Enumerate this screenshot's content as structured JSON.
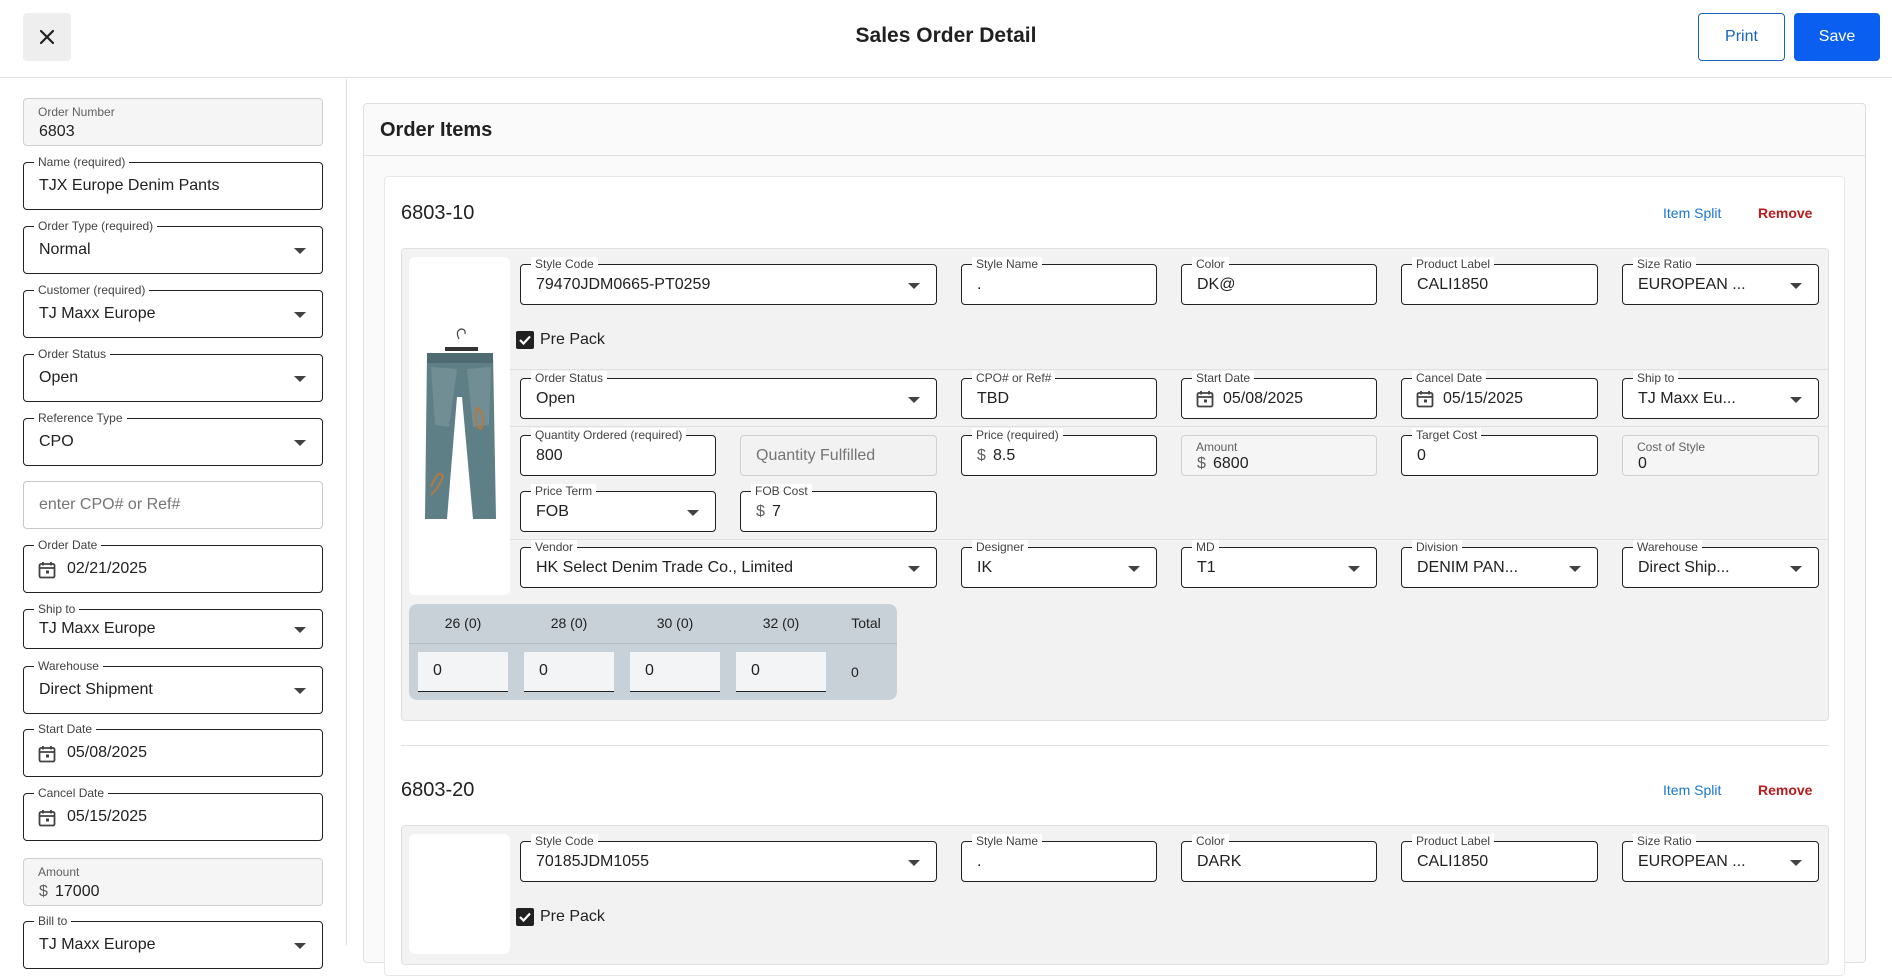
{
  "header": {
    "title": "Sales Order Detail",
    "print_label": "Print",
    "save_label": "Save"
  },
  "order": {
    "order_number_label": "Order Number",
    "order_number": "6803",
    "name_label": "Name (required)",
    "name": "TJX Europe Denim Pants",
    "order_type_label": "Order Type (required)",
    "order_type": "Normal",
    "customer_label": "Customer (required)",
    "customer": "TJ Maxx Europe",
    "order_status_label": "Order Status",
    "order_status": "Open",
    "reference_type_label": "Reference Type",
    "reference_type": "CPO",
    "ref_placeholder": "enter CPO# or Ref#",
    "order_date_label": "Order Date",
    "order_date": "02/21/2025",
    "ship_to_label": "Ship to",
    "ship_to": "TJ Maxx Europe",
    "warehouse_label": "Warehouse",
    "warehouse": "Direct Shipment",
    "start_date_label": "Start Date",
    "start_date": "05/08/2025",
    "cancel_date_label": "Cancel Date",
    "cancel_date": "05/15/2025",
    "amount_label": "Amount",
    "amount_currency": "$",
    "amount": "17000",
    "bill_to_label": "Bill to",
    "bill_to": "TJ Maxx Europe"
  },
  "order_items_title": "Order Items",
  "actions": {
    "item_split": "Item Split",
    "remove": "Remove"
  },
  "items": [
    {
      "id": "6803-10",
      "style_code_label": "Style Code",
      "style_code": "79470JDM0665-PT0259",
      "style_name_label": "Style Name",
      "style_name": ".",
      "color_label": "Color",
      "color": "DK@",
      "product_label_label": "Product Label",
      "product_label": "CALI1850",
      "size_ratio_label": "Size Ratio",
      "size_ratio": "EUROPEAN ...",
      "pre_pack": "Pre Pack",
      "order_status_label": "Order Status",
      "order_status": "Open",
      "cpo_label": "CPO# or Ref#",
      "cpo": "TBD",
      "start_date_label": "Start Date",
      "start_date": "05/08/2025",
      "cancel_date_label": "Cancel Date",
      "cancel_date": "05/15/2025",
      "ship_to_label": "Ship to",
      "ship_to": "TJ Maxx Eu...",
      "qty_ordered_label": "Quantity Ordered (required)",
      "qty_ordered": "800",
      "qty_fulfilled_placeholder": "Quantity Fulfilled",
      "price_label": "Price (required)",
      "price_currency": "$",
      "price": "8.5",
      "amount_label": "Amount",
      "amount_currency": "$",
      "amount": "6800",
      "target_cost_label": "Target Cost",
      "target_cost": "0",
      "cost_of_style_label": "Cost of Style",
      "cost_of_style": "0",
      "price_term_label": "Price Term",
      "price_term": "FOB",
      "fob_cost_label": "FOB Cost",
      "fob_currency": "$",
      "fob_cost": "7",
      "vendor_label": "Vendor",
      "vendor": "HK Select Denim Trade Co., Limited",
      "designer_label": "Designer",
      "designer": "IK",
      "md_label": "MD",
      "md": "T1",
      "division_label": "Division",
      "division": "DENIM PAN...",
      "warehouse_label": "Warehouse",
      "warehouse": "Direct Ship...",
      "sizes": {
        "headers": [
          "26 (0)",
          "28 (0)",
          "30 (0)",
          "32 (0)",
          "Total"
        ],
        "values": [
          "0",
          "0",
          "0",
          "0"
        ],
        "total": "0"
      }
    },
    {
      "id": "6803-20",
      "style_code_label": "Style Code",
      "style_code": "70185JDM1055",
      "style_name_label": "Style Name",
      "style_name": ".",
      "color_label": "Color",
      "color": "DARK",
      "product_label_label": "Product Label",
      "product_label": "CALI1850",
      "size_ratio_label": "Size Ratio",
      "size_ratio": "EUROPEAN ...",
      "pre_pack": "Pre Pack"
    }
  ]
}
